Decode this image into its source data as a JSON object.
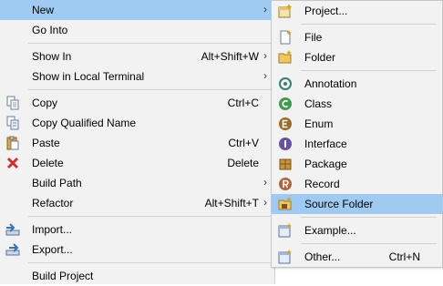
{
  "main_menu": {
    "items": [
      {
        "label": "New",
        "arrow": "›"
      },
      {
        "label": "Go Into"
      },
      {
        "label": "Show In",
        "shortcut": "Alt+Shift+W",
        "arrow": "›"
      },
      {
        "label": "Show in Local Terminal",
        "arrow": "›"
      },
      {
        "label": "Copy",
        "shortcut": "Ctrl+C",
        "icon": "copy-icon"
      },
      {
        "label": "Copy Qualified Name",
        "icon": "copy-qualified-name-icon"
      },
      {
        "label": "Paste",
        "shortcut": "Ctrl+V",
        "icon": "paste-icon"
      },
      {
        "label": "Delete",
        "shortcut": "Delete",
        "icon": "delete-icon"
      },
      {
        "label": "Build Path",
        "arrow": "›"
      },
      {
        "label": "Refactor",
        "shortcut": "Alt+Shift+T",
        "arrow": "›"
      },
      {
        "label": "Import...",
        "icon": "import-icon"
      },
      {
        "label": "Export...",
        "icon": "export-icon"
      },
      {
        "label": "Build Project"
      }
    ]
  },
  "sub_menu": {
    "items": [
      {
        "label": "Project...",
        "icon": "new-project-icon"
      },
      {
        "label": "File",
        "icon": "file-icon"
      },
      {
        "label": "Folder",
        "icon": "folder-icon"
      },
      {
        "label": "Annotation",
        "icon": "annotation-icon"
      },
      {
        "label": "Class",
        "icon": "class-icon"
      },
      {
        "label": "Enum",
        "icon": "enum-icon"
      },
      {
        "label": "Interface",
        "icon": "interface-icon"
      },
      {
        "label": "Package",
        "icon": "package-icon"
      },
      {
        "label": "Record",
        "icon": "record-icon"
      },
      {
        "label": "Source Folder",
        "icon": "source-folder-icon",
        "highlighted": true
      },
      {
        "label": "Example...",
        "icon": "example-icon"
      },
      {
        "label": "Other...",
        "shortcut": "Ctrl+N",
        "icon": "other-icon"
      }
    ]
  },
  "colors": {
    "menu_background": "#f2f2f2",
    "highlight": "#9fcbf2",
    "separator": "#d2d2d2"
  }
}
